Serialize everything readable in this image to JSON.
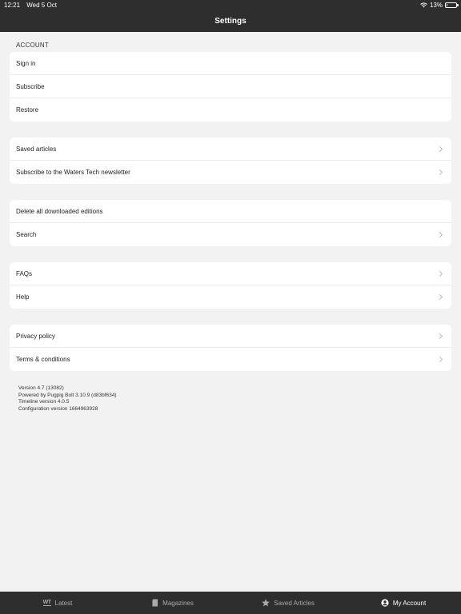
{
  "status": {
    "time": "12:21",
    "date": "Wed 5 Oct",
    "battery": "13%",
    "battery_level": 0.13
  },
  "nav": {
    "title": "Settings"
  },
  "sections": {
    "account": {
      "header": "ACCOUNT",
      "items": [
        "Sign in",
        "Subscribe",
        "Restore"
      ]
    },
    "saved": {
      "items": [
        "Saved articles",
        "Subscribe to the Waters Tech newsletter"
      ]
    },
    "downloads": {
      "items": [
        "Delete all downloaded editions",
        "Search"
      ]
    },
    "support": {
      "items": [
        "FAQs",
        "Help"
      ]
    },
    "legal": {
      "items": [
        "Privacy policy",
        "Terms & conditions"
      ]
    }
  },
  "version": {
    "line1": "Version 4.7 (13082)",
    "line2": "Powered by Pugpig Bolt 3.10.9 (d83bf634)",
    "line3": "Timeline version 4.0.5",
    "line4": "Configuration version 1664963928"
  },
  "tabs": {
    "latest": "Latest",
    "latest_logo": "WT",
    "magazines": "Magazines",
    "saved": "Saved Articles",
    "account": "My Account"
  },
  "colors": {
    "bar_bg": "#2e2e2e",
    "page_bg": "#f2f2f2",
    "card_bg": "#ffffff"
  }
}
